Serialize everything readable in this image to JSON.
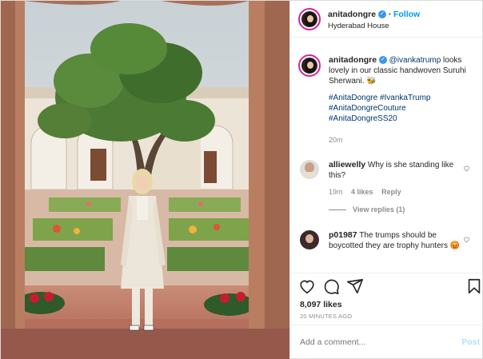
{
  "header": {
    "username": "anitadongre",
    "verified_icon": "verified-badge-icon",
    "separator": "•",
    "follow_label": "Follow",
    "location": "Hyderabad House"
  },
  "caption": {
    "username": "anitadongre",
    "mention": "@ivankatrump",
    "text": " looks lovely in our classic handwoven Suruhi Sherwani. 🐝",
    "hashtags": [
      "#AnitaDongre",
      "#IvankaTrump",
      "#AnitaDongreCouture",
      "#AnitaDongreSS20"
    ],
    "time": "20m"
  },
  "comments": [
    {
      "username": "alliewelly",
      "text": "Why is she standing like this?",
      "time": "19m",
      "likes": "4 likes",
      "reply_label": "Reply",
      "view_replies": "View replies (1)"
    },
    {
      "username": "p01987",
      "text": "The trumps should be boycotted they are trophy hunters 😡"
    }
  ],
  "actions": {
    "likes": "8,097 likes",
    "timestamp": "20 MINUTES AGO"
  },
  "add_comment": {
    "placeholder": "Add a comment...",
    "post_label": "Post"
  },
  "colors": {
    "accent": "#0095f6",
    "link": "#00376b",
    "muted": "#8e8e8e",
    "border": "#efefef"
  }
}
